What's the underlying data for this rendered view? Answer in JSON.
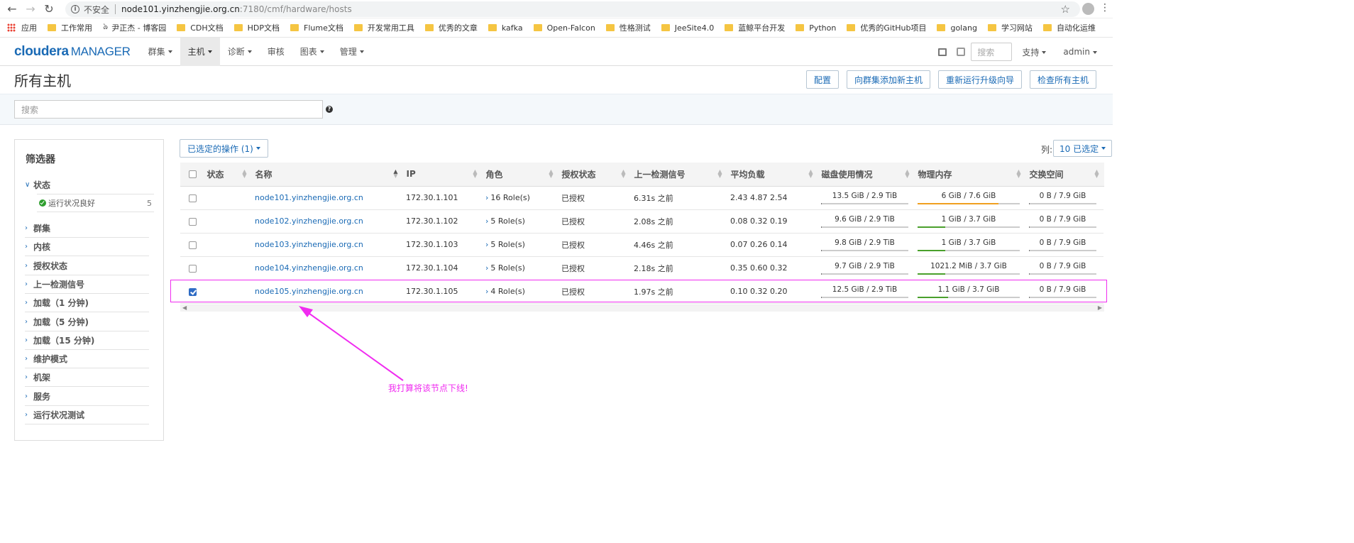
{
  "browser": {
    "insecure_label": "不安全",
    "url_host": "node101.yinzhengjie.org.cn",
    "url_path": ":7180/cmf/hardware/hosts"
  },
  "bookmarks": [
    {
      "label": "应用",
      "type": "apps"
    },
    {
      "label": "工作常用",
      "type": "folder"
    },
    {
      "label": "尹正杰 - 博客园",
      "type": "site"
    },
    {
      "label": "CDH文档",
      "type": "folder"
    },
    {
      "label": "HDP文档",
      "type": "folder"
    },
    {
      "label": "Flume文档",
      "type": "folder"
    },
    {
      "label": "开发常用工具",
      "type": "folder"
    },
    {
      "label": "优秀的文章",
      "type": "folder"
    },
    {
      "label": "kafka",
      "type": "folder"
    },
    {
      "label": "Open-Falcon",
      "type": "folder"
    },
    {
      "label": "性格测试",
      "type": "folder"
    },
    {
      "label": "JeeSite4.0",
      "type": "folder"
    },
    {
      "label": "蓝鲸平台开发",
      "type": "folder"
    },
    {
      "label": "Python",
      "type": "folder"
    },
    {
      "label": "优秀的GitHub项目",
      "type": "folder"
    },
    {
      "label": "golang",
      "type": "folder"
    },
    {
      "label": "学习网站",
      "type": "folder"
    },
    {
      "label": "自动化运维",
      "type": "folder"
    }
  ],
  "header": {
    "logo_brand": "cloudera",
    "logo_product": "MANAGER",
    "nav": [
      "群集",
      "主机",
      "诊断",
      "审核",
      "图表",
      "管理"
    ],
    "nav_has_caret": [
      true,
      true,
      true,
      false,
      true,
      true
    ],
    "active_nav": 1,
    "search_placeholder": "搜索",
    "support": "支持",
    "user": "admin"
  },
  "page": {
    "title": "所有主机",
    "buttons": [
      "配置",
      "向群集添加新主机",
      "重新运行升级向导",
      "检查所有主机"
    ],
    "search_placeholder": "搜索"
  },
  "filters": {
    "title": "筛选器",
    "status_group": "状态",
    "status_item": "运行状况良好",
    "status_count": "5",
    "groups": [
      "群集",
      "内核",
      "授权状态",
      "上一检测信号",
      "加载（1 分钟)",
      "加载（5 分钟)",
      "加载（15 分钟)",
      "维护模式",
      "机架",
      "服务",
      "运行状况测试"
    ]
  },
  "toolbar": {
    "actions_label": "已选定的操作 (1)",
    "columns_label": "列:",
    "columns_value": "10 已选定"
  },
  "table": {
    "headers": [
      "",
      "状态",
      "名称",
      "IP",
      "角色",
      "授权状态",
      "上一检测信号",
      "平均负载",
      "磁盘使用情况",
      "物理内存",
      "交换空间"
    ],
    "rows": [
      {
        "checked": false,
        "name": "node101.yinzhengjie.org.cn",
        "ip": "172.30.1.101",
        "roles": "16 Role(s)",
        "auth": "已授权",
        "heartbeat": "6.31s 之前",
        "load": "2.43  4.87  2.54",
        "disk": "13.5 GiB / 2.9 TiB",
        "disk_frac": 0.005,
        "mem": "6 GiB / 7.6 GiB",
        "mem_frac": 0.79,
        "mem_color": "#f0a020",
        "swap": "0 B / 7.9 GiB"
      },
      {
        "checked": false,
        "name": "node102.yinzhengjie.org.cn",
        "ip": "172.30.1.102",
        "roles": "5 Role(s)",
        "auth": "已授权",
        "heartbeat": "2.08s 之前",
        "load": "0.08  0.32  0.19",
        "disk": "9.6 GiB / 2.9 TiB",
        "disk_frac": 0.003,
        "mem": "1 GiB / 3.7 GiB",
        "mem_frac": 0.27,
        "mem_color": "#4aa02c",
        "swap": "0 B / 7.9 GiB"
      },
      {
        "checked": false,
        "name": "node103.yinzhengjie.org.cn",
        "ip": "172.30.1.103",
        "roles": "5 Role(s)",
        "auth": "已授权",
        "heartbeat": "4.46s 之前",
        "load": "0.07  0.26  0.14",
        "disk": "9.8 GiB / 2.9 TiB",
        "disk_frac": 0.003,
        "mem": "1 GiB / 3.7 GiB",
        "mem_frac": 0.27,
        "mem_color": "#4aa02c",
        "swap": "0 B / 7.9 GiB"
      },
      {
        "checked": false,
        "name": "node104.yinzhengjie.org.cn",
        "ip": "172.30.1.104",
        "roles": "5 Role(s)",
        "auth": "已授权",
        "heartbeat": "2.18s 之前",
        "load": "0.35  0.60  0.32",
        "disk": "9.7 GiB / 2.9 TiB",
        "disk_frac": 0.003,
        "mem": "1021.2 MiB / 3.7 GiB",
        "mem_frac": 0.27,
        "mem_color": "#4aa02c",
        "swap": "0 B / 7.9 GiB"
      },
      {
        "checked": true,
        "name": "node105.yinzhengjie.org.cn",
        "ip": "172.30.1.105",
        "roles": "4 Role(s)",
        "auth": "已授权",
        "heartbeat": "1.97s 之前",
        "load": "0.10  0.32  0.20",
        "disk": "12.5 GiB / 2.9 TiB",
        "disk_frac": 0.004,
        "mem": "1.1 GiB / 3.7 GiB",
        "mem_frac": 0.3,
        "mem_color": "#4aa02c",
        "swap": "0 B / 7.9 GiB"
      }
    ]
  },
  "annotation": {
    "text": "我打算将该节点下线!",
    "color": "#f02cf0"
  },
  "colors": {
    "accent": "#1a6ab5",
    "ok_green": "#2e9e2e"
  }
}
